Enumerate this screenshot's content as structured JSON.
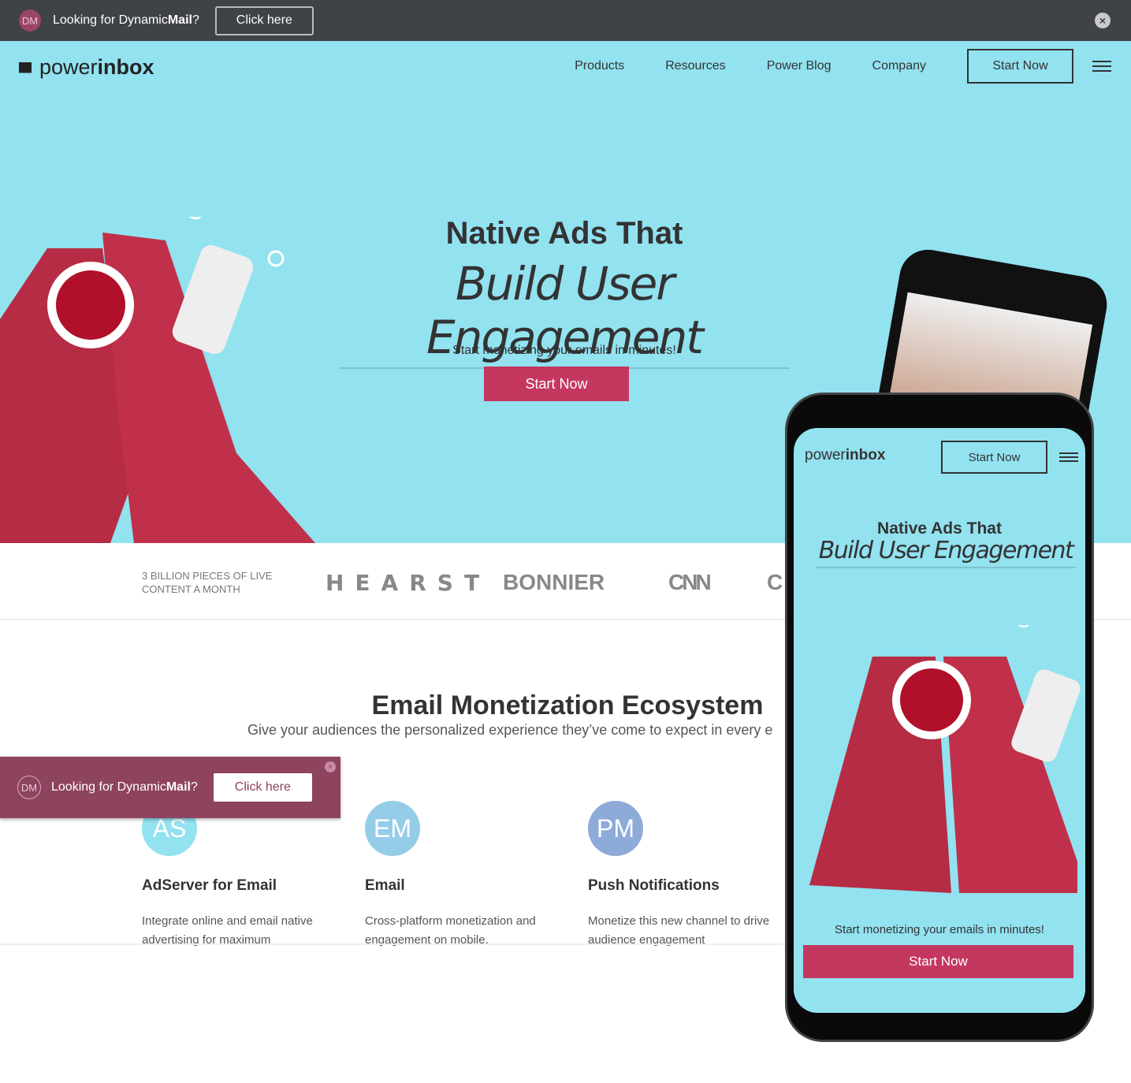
{
  "topbar": {
    "avatar": "DM",
    "message_prefix": "Looking for Dynamic",
    "message_bold": "Mail",
    "message_suffix": "?",
    "button": "Click here",
    "close_icon": "close-circle-icon"
  },
  "header": {
    "logo_light": "power",
    "logo_bold": "inbox",
    "nav": [
      "Products",
      "Resources",
      "Power Blog",
      "Company"
    ],
    "start": "Start Now",
    "menu_icon": "hamburger-icon"
  },
  "hero": {
    "title": "Native Ads That",
    "subtitle": "Build User Engagement",
    "tagline": "Start monetizing your emails in minutes!",
    "cta": "Start Now"
  },
  "logos": {
    "claim_line1": "3 BILLION PIECES OF LIVE",
    "claim_line2": "CONTENT A MONTH",
    "brands": [
      "HEARST",
      "BONNIER",
      "CNN",
      "C"
    ]
  },
  "ecosystem": {
    "title": "Email Monetization Ecosystem",
    "subtitle": "Give your audiences the personalized experience they’ve come to expect in every e",
    "cards": [
      {
        "badge": "AS",
        "color": "#92e2f0",
        "title": "AdServer for Email",
        "text": "Integrate online and email native advertising for maximum"
      },
      {
        "badge": "EM",
        "color": "#95cde9",
        "title": "Email",
        "text": "Cross-platform monetization and engagement on mobile,"
      },
      {
        "badge": "PM",
        "color": "#8eaad8",
        "title": "Push Notifications",
        "text": "Monetize this new channel to drive audience engagement"
      }
    ]
  },
  "popup": {
    "avatar": "DM",
    "message_prefix": "Looking for Dynamic",
    "message_bold": "Mail",
    "message_suffix": "?",
    "button": "Click here"
  },
  "phone": {
    "logo_light": "power",
    "logo_bold": "inbox",
    "start": "Start Now",
    "title": "Native Ads That",
    "subtitle": "Build User Engagement",
    "tagline": "Start monetizing your emails in minutes!",
    "cta": "Start Now"
  },
  "colors": {
    "topbar": "#3f4246",
    "hero": "#92e2f0",
    "accent": "#c4385f",
    "popup": "#8e435f"
  }
}
